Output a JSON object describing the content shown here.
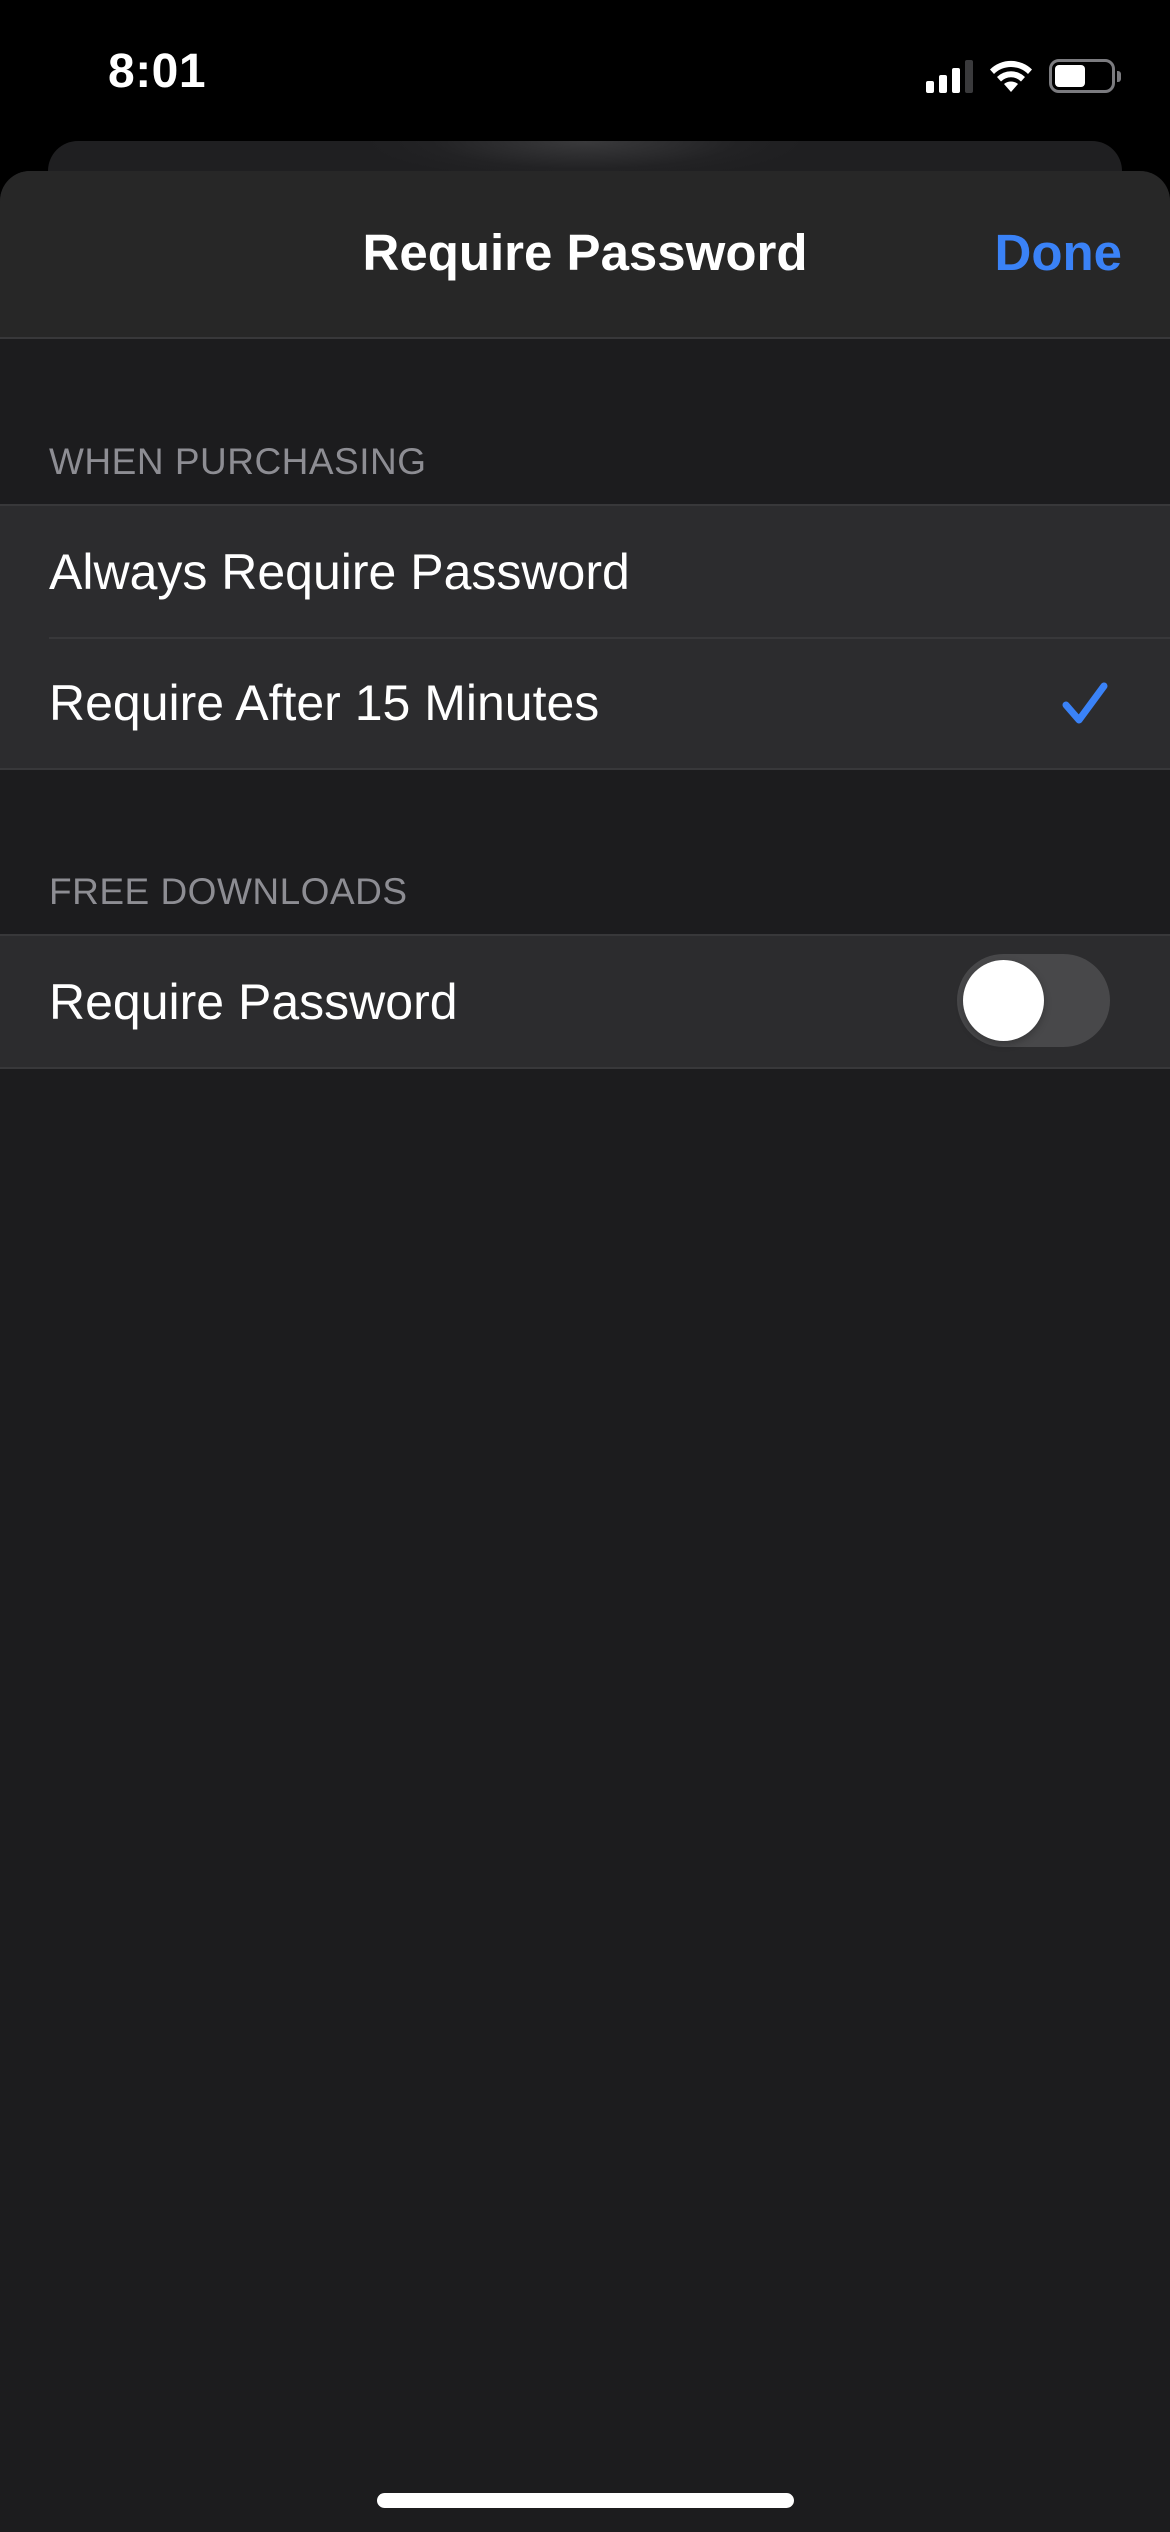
{
  "status_bar": {
    "time": "8:01",
    "signal_bars_active": 3,
    "signal_bars_total": 4,
    "wifi": "wifi-icon",
    "battery_level_percent": 55
  },
  "sheet": {
    "title": "Require Password",
    "done_label": "Done",
    "accent_color": "#3a82f7"
  },
  "sections": [
    {
      "header": "When Purchasing",
      "rows": [
        {
          "label": "Always Require Password",
          "selected": false
        },
        {
          "label": "Require After 15 Minutes",
          "selected": true
        }
      ]
    },
    {
      "header": "Free Downloads",
      "rows": [
        {
          "label": "Require Password",
          "toggle": false
        }
      ]
    }
  ]
}
